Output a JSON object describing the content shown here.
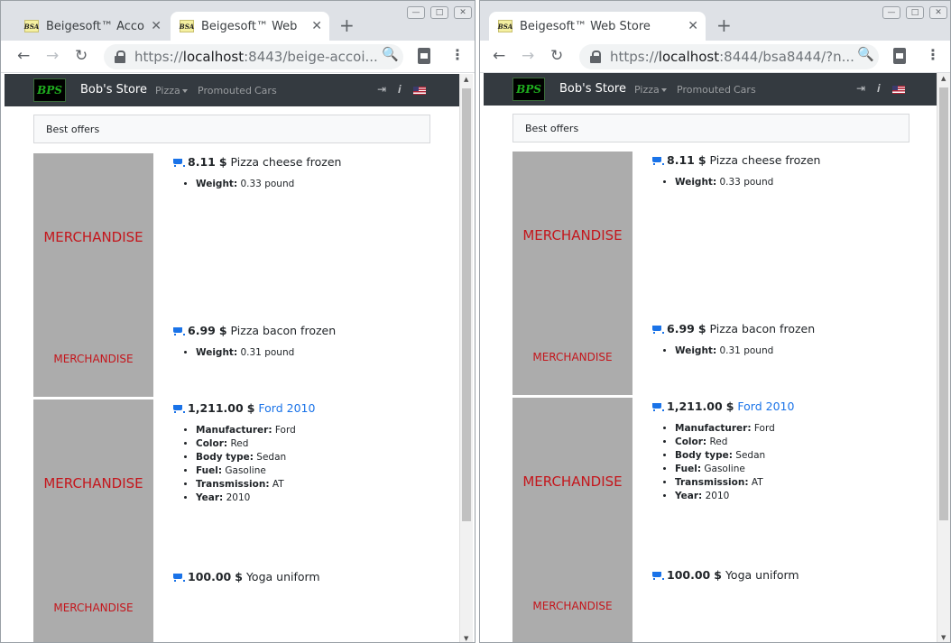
{
  "left": {
    "tabs": [
      {
        "favicon": "BSA",
        "title": "Beigesoft™ Acco",
        "close": "✕"
      },
      {
        "favicon": "BSA",
        "title": "Beigesoft™ Web",
        "close": "✕"
      }
    ],
    "newtab": "+",
    "address": {
      "scheme": "https://",
      "host": "localhost",
      "rest": ":8443/beige-accoi..."
    }
  },
  "right": {
    "tabs": [
      {
        "favicon": "BSA",
        "title": "Beigesoft™ Web Store",
        "close": "✕"
      }
    ],
    "newtab": "+",
    "address": {
      "scheme": "https://",
      "host": "localhost",
      "rest": ":8444/bsa8444/?n..."
    }
  },
  "store": {
    "logo": "BPS",
    "brand": "Bob's Store",
    "nav": {
      "pizza": "Pizza",
      "promouted": "Promouted",
      "cars": "Cars"
    },
    "panel_title": "Best offers",
    "thumb_label": "MERCHANDISE",
    "currency": "$",
    "items": [
      {
        "price": "8.11",
        "name": "Pizza cheese frozen",
        "specs": [
          {
            "label": "Weight:",
            "value": "0.33 pound"
          }
        ]
      },
      {
        "price": "6.99",
        "name": "Pizza bacon frozen",
        "specs": [
          {
            "label": "Weight:",
            "value": "0.31 pound"
          }
        ]
      },
      {
        "price": "1,211.00",
        "name": "Ford 2010",
        "specs": [
          {
            "label": "Manufacturer:",
            "value": "Ford"
          },
          {
            "label": "Color:",
            "value": "Red"
          },
          {
            "label": "Body type:",
            "value": "Sedan"
          },
          {
            "label": "Fuel:",
            "value": "Gasoline"
          },
          {
            "label": "Transmission:",
            "value": "AT"
          },
          {
            "label": "Year:",
            "value": "2010"
          }
        ]
      },
      {
        "price": "100.00",
        "name": "Yoga uniform",
        "specs": []
      }
    ]
  },
  "icons": {
    "back": "←",
    "forward": "→",
    "reload": "↻",
    "zoom": "🔍",
    "menu": "⋮",
    "login": "⇥",
    "info": "𝒊",
    "minimize": "—",
    "maximize": "□",
    "close": "✕",
    "scroll_up": "▲",
    "scroll_down": "▼"
  },
  "colors": {
    "navbar": "#343a40",
    "link": "#1a73e8",
    "merch_bg": "#acacac",
    "merch_text": "#c4161c"
  }
}
